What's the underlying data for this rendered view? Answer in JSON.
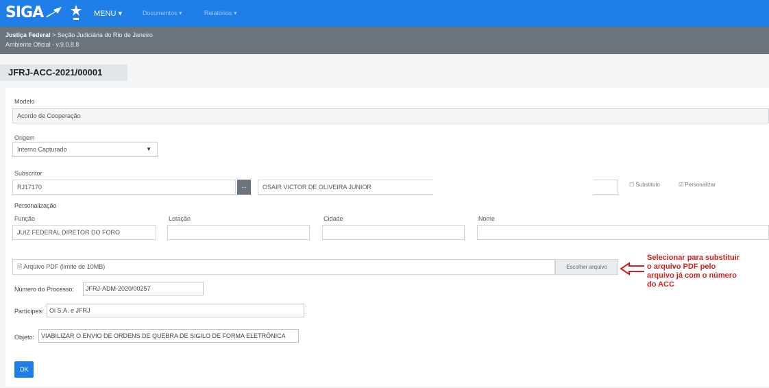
{
  "app": {
    "logo": "SIGA",
    "menu": "MENU ▾",
    "menu_documents": "Documentos ▾",
    "menu_reports": "Relatórios ▾"
  },
  "breadcrumb": {
    "root": "Justiça Federal",
    "separator": " > ",
    "section": "Seção Judiciária do Rio de Janeiro",
    "environment": "Ambiente Oficial - v.9.0.8.8"
  },
  "document": {
    "code": "JFRJ-ACC-2021/00001"
  },
  "form": {
    "modelo": {
      "label": "Modelo",
      "value": "Acordo de Cooperação"
    },
    "origem": {
      "label": "Origem",
      "value": "Interno Capturado"
    },
    "subscritor": {
      "label": "Subscritor",
      "code": "RJ17170",
      "lookup": "...",
      "name": "OSAIR VICTOR DE OLIVEIRA JUNIOR",
      "substituto": "Substituto",
      "personalizar": "Personalizar"
    },
    "personalizacao": {
      "title": "Personalização",
      "funcao": {
        "label": "Função",
        "value": "JUIZ FEDERAL DIRETOR DO FORO"
      },
      "lotacao": {
        "label": "Lotação",
        "value": ""
      },
      "cidade": {
        "label": "Cidade",
        "value": ""
      },
      "nome": {
        "label": "Nome",
        "value": ""
      }
    },
    "arquivo": {
      "placeholder": "Arquivo PDF (limite de 10MB)",
      "button": "Escolher arquivo"
    },
    "processo": {
      "label": "Número do Processo:",
      "value": "JFRJ-ADM-2020/00257"
    },
    "participes": {
      "label": "Partícipes:",
      "value": "Oi S.A. e JFRJ"
    },
    "objeto": {
      "label": "Objeto:",
      "value": "VIABILIZAR O ENVIO DE ORDENS DE QUEBRA DE SIGILO DE FORMA ELETRÔNICA"
    },
    "ok": "OK"
  },
  "annotation": {
    "text": "Selecionar para substituir o arquivo PDF pelo arquivo já com o número do ACC",
    "color": "#d11f1f"
  },
  "colors": {
    "primary": "#1f7ee8",
    "subbar": "#6c747b"
  }
}
